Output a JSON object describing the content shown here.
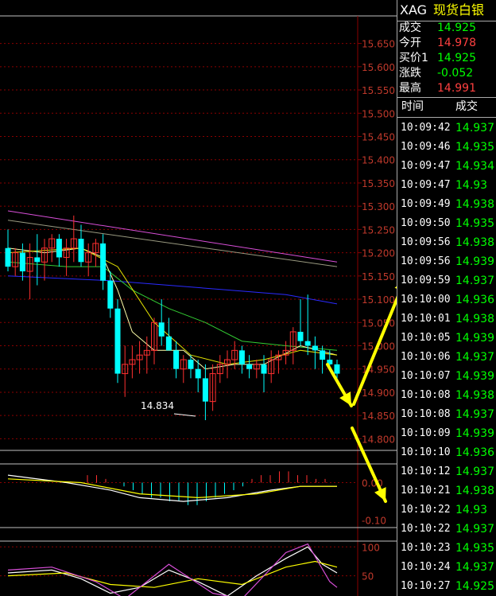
{
  "symbol": {
    "code": "XAG",
    "name": "现货白银"
  },
  "quote": [
    {
      "label": "成交",
      "value": "14.925",
      "color": "#00ff00"
    },
    {
      "label": "今开",
      "value": "14.978",
      "color": "#ff4040"
    },
    {
      "label": "买价1",
      "value": "14.925",
      "color": "#00ff00"
    },
    {
      "label": "涨跌",
      "value": "-0.052",
      "color": "#00ff00"
    },
    {
      "label": "最高",
      "value": "14.991",
      "color": "#ff4040"
    }
  ],
  "ticks_header": {
    "time": "时间",
    "price": "成交"
  },
  "ticks": [
    {
      "time": "10:09:42",
      "price": "14.937"
    },
    {
      "time": "10:09:46",
      "price": "14.935"
    },
    {
      "time": "10:09:47",
      "price": "14.934"
    },
    {
      "time": "10:09:47",
      "price": "14.93"
    },
    {
      "time": "10:09:49",
      "price": "14.938"
    },
    {
      "time": "10:09:50",
      "price": "14.935"
    },
    {
      "time": "10:09:56",
      "price": "14.938"
    },
    {
      "time": "10:09:56",
      "price": "14.939"
    },
    {
      "time": "10:09:59",
      "price": "14.937"
    },
    {
      "time": "10:10:00",
      "price": "14.936"
    },
    {
      "time": "10:10:01",
      "price": "14.938"
    },
    {
      "time": "10:10:05",
      "price": "14.939"
    },
    {
      "time": "10:10:06",
      "price": "14.937"
    },
    {
      "time": "10:10:07",
      "price": "14.939"
    },
    {
      "time": "10:10:08",
      "price": "14.938"
    },
    {
      "time": "10:10:08",
      "price": "14.937"
    },
    {
      "time": "10:10:09",
      "price": "14.939"
    },
    {
      "time": "10:10:10",
      "price": "14.936"
    },
    {
      "time": "10:10:12",
      "price": "14.937"
    },
    {
      "time": "10:10:21",
      "price": "14.938"
    },
    {
      "time": "10:10:22",
      "price": "14.93"
    },
    {
      "time": "10:10:22",
      "price": "14.937"
    },
    {
      "time": "10:10:23",
      "price": "14.935"
    },
    {
      "time": "10:10:24",
      "price": "14.937"
    },
    {
      "time": "10:10:27",
      "price": "14.925"
    }
  ],
  "price_axis": {
    "labels": [
      "15.650",
      "15.600",
      "15.550",
      "15.500",
      "15.450",
      "15.400",
      "15.350",
      "15.300",
      "15.250",
      "15.200",
      "15.150",
      "15.100",
      "15.050",
      "15.000",
      "14.950",
      "14.900",
      "14.850",
      "14.800"
    ],
    "min_value": 14.834,
    "min_label": "14.834"
  },
  "macd_axis": {
    "labels": [
      "0.00",
      "-0.10"
    ]
  },
  "kdj_axis": {
    "labels": [
      "100",
      "50"
    ]
  },
  "colors": {
    "background": "#000000",
    "grid": "#8b0000",
    "axis_text": "#c0392b",
    "up": "#ff3030",
    "down": "#00ffff",
    "annotation_arrow": "#ffff00",
    "ma_magenta": "#d94fd9",
    "ma_blue": "#2a2aff",
    "ma_green": "#33cc33",
    "ma_white": "#ffffaa",
    "ma_yellow": "#e6e600"
  },
  "chart_data": {
    "type": "candlestick",
    "ylim": [
      14.775,
      15.675
    ],
    "candles": [
      {
        "o": 15.21,
        "h": 15.25,
        "l": 15.16,
        "c": 15.17
      },
      {
        "o": 15.17,
        "h": 15.21,
        "l": 15.15,
        "c": 15.2
      },
      {
        "o": 15.2,
        "h": 15.22,
        "l": 15.14,
        "c": 15.16
      },
      {
        "o": 15.16,
        "h": 15.22,
        "l": 15.1,
        "c": 15.19
      },
      {
        "o": 15.19,
        "h": 15.24,
        "l": 15.13,
        "c": 15.18
      },
      {
        "o": 15.18,
        "h": 15.23,
        "l": 15.14,
        "c": 15.21
      },
      {
        "o": 15.21,
        "h": 15.24,
        "l": 15.18,
        "c": 15.23
      },
      {
        "o": 15.23,
        "h": 15.24,
        "l": 15.17,
        "c": 15.19
      },
      {
        "o": 15.19,
        "h": 15.23,
        "l": 15.15,
        "c": 15.21
      },
      {
        "o": 15.21,
        "h": 15.28,
        "l": 15.18,
        "c": 15.23
      },
      {
        "o": 15.23,
        "h": 15.26,
        "l": 15.17,
        "c": 15.18
      },
      {
        "o": 15.18,
        "h": 15.22,
        "l": 15.15,
        "c": 15.2
      },
      {
        "o": 15.2,
        "h": 15.23,
        "l": 15.17,
        "c": 15.22
      },
      {
        "o": 15.22,
        "h": 15.24,
        "l": 15.12,
        "c": 15.14
      },
      {
        "o": 15.14,
        "h": 15.16,
        "l": 15.06,
        "c": 15.08
      },
      {
        "o": 15.08,
        "h": 15.1,
        "l": 14.92,
        "c": 14.94
      },
      {
        "o": 14.94,
        "h": 15.0,
        "l": 14.89,
        "c": 14.96
      },
      {
        "o": 14.96,
        "h": 15.0,
        "l": 14.93,
        "c": 14.97
      },
      {
        "o": 14.97,
        "h": 15.01,
        "l": 14.94,
        "c": 14.98
      },
      {
        "o": 14.98,
        "h": 15.02,
        "l": 14.94,
        "c": 14.99
      },
      {
        "o": 14.99,
        "h": 15.06,
        "l": 14.96,
        "c": 15.05
      },
      {
        "o": 15.05,
        "h": 15.1,
        "l": 15.0,
        "c": 15.02
      },
      {
        "o": 15.02,
        "h": 15.06,
        "l": 15.0,
        "c": 14.99
      },
      {
        "o": 14.99,
        "h": 15.01,
        "l": 14.93,
        "c": 14.95
      },
      {
        "o": 14.95,
        "h": 14.98,
        "l": 14.92,
        "c": 14.97
      },
      {
        "o": 14.97,
        "h": 14.98,
        "l": 14.93,
        "c": 14.95
      },
      {
        "o": 14.95,
        "h": 14.97,
        "l": 14.9,
        "c": 14.93
      },
      {
        "o": 14.93,
        "h": 14.96,
        "l": 14.84,
        "c": 14.88
      },
      {
        "o": 14.88,
        "h": 14.96,
        "l": 14.86,
        "c": 14.94
      },
      {
        "o": 14.94,
        "h": 14.98,
        "l": 14.92,
        "c": 14.96
      },
      {
        "o": 14.96,
        "h": 14.99,
        "l": 14.93,
        "c": 14.97
      },
      {
        "o": 14.97,
        "h": 15.01,
        "l": 14.95,
        "c": 14.99
      },
      {
        "o": 14.99,
        "h": 15.0,
        "l": 14.94,
        "c": 14.96
      },
      {
        "o": 14.96,
        "h": 14.98,
        "l": 14.93,
        "c": 14.95
      },
      {
        "o": 14.95,
        "h": 14.97,
        "l": 14.93,
        "c": 14.96
      },
      {
        "o": 14.96,
        "h": 14.98,
        "l": 14.9,
        "c": 14.94
      },
      {
        "o": 14.94,
        "h": 14.99,
        "l": 14.92,
        "c": 14.97
      },
      {
        "o": 14.97,
        "h": 14.99,
        "l": 14.94,
        "c": 14.98
      },
      {
        "o": 14.98,
        "h": 15.01,
        "l": 14.96,
        "c": 14.99
      },
      {
        "o": 14.99,
        "h": 15.04,
        "l": 14.96,
        "c": 15.03
      },
      {
        "o": 15.03,
        "h": 15.1,
        "l": 15.0,
        "c": 15.01
      },
      {
        "o": 15.01,
        "h": 15.11,
        "l": 14.98,
        "c": 15.0
      },
      {
        "o": 15.0,
        "h": 15.02,
        "l": 14.95,
        "c": 14.99
      },
      {
        "o": 14.99,
        "h": 15.0,
        "l": 14.94,
        "c": 14.97
      },
      {
        "o": 14.97,
        "h": 14.99,
        "l": 14.95,
        "c": 14.96
      },
      {
        "o": 14.96,
        "h": 14.97,
        "l": 14.93,
        "c": 14.94
      }
    ],
    "moving_averages": [
      {
        "color": "#d94fd9",
        "points": [
          [
            0,
            15.29
          ],
          [
            45,
            15.18
          ]
        ]
      },
      {
        "color": "#9a9a80",
        "points": [
          [
            0,
            15.27
          ],
          [
            45,
            15.17
          ]
        ]
      },
      {
        "color": "#2a2aff",
        "points": [
          [
            0,
            15.15
          ],
          [
            14,
            15.14
          ],
          [
            22,
            15.13
          ],
          [
            30,
            15.12
          ],
          [
            38,
            15.11
          ],
          [
            45,
            15.09
          ]
        ]
      },
      {
        "color": "#33cc33",
        "points": [
          [
            0,
            15.18
          ],
          [
            8,
            15.17
          ],
          [
            13,
            15.17
          ],
          [
            17,
            15.12
          ],
          [
            22,
            15.08
          ],
          [
            27,
            15.05
          ],
          [
            32,
            15.01
          ],
          [
            38,
            15.0
          ],
          [
            45,
            14.99
          ]
        ]
      },
      {
        "color": "#ffffaa",
        "points": [
          [
            0,
            15.21
          ],
          [
            5,
            15.2
          ],
          [
            10,
            15.21
          ],
          [
            13,
            15.19
          ],
          [
            15,
            15.12
          ],
          [
            17,
            15.03
          ],
          [
            20,
            14.99
          ],
          [
            24,
            14.99
          ],
          [
            27,
            14.95
          ],
          [
            31,
            14.96
          ],
          [
            35,
            14.96
          ],
          [
            40,
            15.0
          ],
          [
            45,
            14.98
          ]
        ]
      },
      {
        "color": "#e6e600",
        "points": [
          [
            0,
            15.2
          ],
          [
            10,
            15.21
          ],
          [
            15,
            15.17
          ],
          [
            20,
            15.05
          ],
          [
            25,
            14.98
          ],
          [
            30,
            14.96
          ],
          [
            35,
            14.97
          ],
          [
            40,
            14.99
          ],
          [
            45,
            14.98
          ]
        ]
      }
    ],
    "macd": {
      "bars": [
        0.02,
        0.02,
        0.01,
        0.0,
        -0.01,
        -0.02,
        -0.03,
        -0.04,
        -0.04,
        -0.05,
        -0.05,
        -0.06,
        -0.06,
        -0.05,
        -0.04,
        -0.03,
        -0.02,
        -0.01,
        0.01,
        0.02,
        0.02,
        0.03,
        0.03,
        0.02,
        0.02,
        0.01,
        0.01
      ],
      "dif": [
        [
          0,
          0.02
        ],
        [
          8,
          0.0
        ],
        [
          14,
          -0.02
        ],
        [
          18,
          -0.04
        ],
        [
          24,
          -0.05
        ],
        [
          30,
          -0.04
        ],
        [
          36,
          -0.02
        ],
        [
          40,
          -0.01
        ],
        [
          45,
          -0.01
        ]
      ],
      "dea": [
        [
          0,
          0.01
        ],
        [
          10,
          0.0
        ],
        [
          18,
          -0.03
        ],
        [
          26,
          -0.04
        ],
        [
          34,
          -0.03
        ],
        [
          40,
          -0.01
        ],
        [
          45,
          -0.01
        ]
      ]
    },
    "kdj": {
      "k": [
        [
          0,
          55
        ],
        [
          6,
          60
        ],
        [
          10,
          45
        ],
        [
          14,
          20
        ],
        [
          18,
          30
        ],
        [
          22,
          60
        ],
        [
          26,
          40
        ],
        [
          30,
          15
        ],
        [
          34,
          50
        ],
        [
          38,
          80
        ],
        [
          41,
          100
        ],
        [
          43,
          70
        ],
        [
          45,
          55
        ]
      ],
      "d": [
        [
          0,
          50
        ],
        [
          8,
          55
        ],
        [
          14,
          35
        ],
        [
          20,
          30
        ],
        [
          26,
          45
        ],
        [
          32,
          35
        ],
        [
          38,
          65
        ],
        [
          42,
          75
        ],
        [
          45,
          65
        ]
      ],
      "j": [
        [
          0,
          60
        ],
        [
          6,
          65
        ],
        [
          12,
          40
        ],
        [
          16,
          10
        ],
        [
          22,
          70
        ],
        [
          28,
          20
        ],
        [
          32,
          10
        ],
        [
          38,
          90
        ],
        [
          41,
          105
        ],
        [
          44,
          40
        ],
        [
          45,
          30
        ]
      ]
    }
  }
}
